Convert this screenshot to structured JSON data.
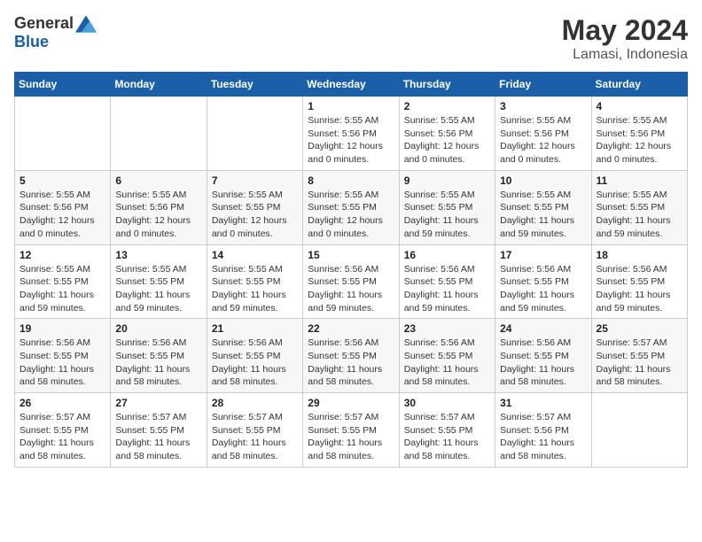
{
  "header": {
    "logo_general": "General",
    "logo_blue": "Blue",
    "month": "May 2024",
    "location": "Lamasi, Indonesia"
  },
  "weekdays": [
    "Sunday",
    "Monday",
    "Tuesday",
    "Wednesday",
    "Thursday",
    "Friday",
    "Saturday"
  ],
  "weeks": [
    [
      {
        "day": "",
        "info": ""
      },
      {
        "day": "",
        "info": ""
      },
      {
        "day": "",
        "info": ""
      },
      {
        "day": "1",
        "info": "Sunrise: 5:55 AM\nSunset: 5:56 PM\nDaylight: 12 hours and 0 minutes."
      },
      {
        "day": "2",
        "info": "Sunrise: 5:55 AM\nSunset: 5:56 PM\nDaylight: 12 hours and 0 minutes."
      },
      {
        "day": "3",
        "info": "Sunrise: 5:55 AM\nSunset: 5:56 PM\nDaylight: 12 hours and 0 minutes."
      },
      {
        "day": "4",
        "info": "Sunrise: 5:55 AM\nSunset: 5:56 PM\nDaylight: 12 hours and 0 minutes."
      }
    ],
    [
      {
        "day": "5",
        "info": "Sunrise: 5:55 AM\nSunset: 5:56 PM\nDaylight: 12 hours and 0 minutes."
      },
      {
        "day": "6",
        "info": "Sunrise: 5:55 AM\nSunset: 5:56 PM\nDaylight: 12 hours and 0 minutes."
      },
      {
        "day": "7",
        "info": "Sunrise: 5:55 AM\nSunset: 5:55 PM\nDaylight: 12 hours and 0 minutes."
      },
      {
        "day": "8",
        "info": "Sunrise: 5:55 AM\nSunset: 5:55 PM\nDaylight: 12 hours and 0 minutes."
      },
      {
        "day": "9",
        "info": "Sunrise: 5:55 AM\nSunset: 5:55 PM\nDaylight: 11 hours and 59 minutes."
      },
      {
        "day": "10",
        "info": "Sunrise: 5:55 AM\nSunset: 5:55 PM\nDaylight: 11 hours and 59 minutes."
      },
      {
        "day": "11",
        "info": "Sunrise: 5:55 AM\nSunset: 5:55 PM\nDaylight: 11 hours and 59 minutes."
      }
    ],
    [
      {
        "day": "12",
        "info": "Sunrise: 5:55 AM\nSunset: 5:55 PM\nDaylight: 11 hours and 59 minutes."
      },
      {
        "day": "13",
        "info": "Sunrise: 5:55 AM\nSunset: 5:55 PM\nDaylight: 11 hours and 59 minutes."
      },
      {
        "day": "14",
        "info": "Sunrise: 5:55 AM\nSunset: 5:55 PM\nDaylight: 11 hours and 59 minutes."
      },
      {
        "day": "15",
        "info": "Sunrise: 5:56 AM\nSunset: 5:55 PM\nDaylight: 11 hours and 59 minutes."
      },
      {
        "day": "16",
        "info": "Sunrise: 5:56 AM\nSunset: 5:55 PM\nDaylight: 11 hours and 59 minutes."
      },
      {
        "day": "17",
        "info": "Sunrise: 5:56 AM\nSunset: 5:55 PM\nDaylight: 11 hours and 59 minutes."
      },
      {
        "day": "18",
        "info": "Sunrise: 5:56 AM\nSunset: 5:55 PM\nDaylight: 11 hours and 59 minutes."
      }
    ],
    [
      {
        "day": "19",
        "info": "Sunrise: 5:56 AM\nSunset: 5:55 PM\nDaylight: 11 hours and 58 minutes."
      },
      {
        "day": "20",
        "info": "Sunrise: 5:56 AM\nSunset: 5:55 PM\nDaylight: 11 hours and 58 minutes."
      },
      {
        "day": "21",
        "info": "Sunrise: 5:56 AM\nSunset: 5:55 PM\nDaylight: 11 hours and 58 minutes."
      },
      {
        "day": "22",
        "info": "Sunrise: 5:56 AM\nSunset: 5:55 PM\nDaylight: 11 hours and 58 minutes."
      },
      {
        "day": "23",
        "info": "Sunrise: 5:56 AM\nSunset: 5:55 PM\nDaylight: 11 hours and 58 minutes."
      },
      {
        "day": "24",
        "info": "Sunrise: 5:56 AM\nSunset: 5:55 PM\nDaylight: 11 hours and 58 minutes."
      },
      {
        "day": "25",
        "info": "Sunrise: 5:57 AM\nSunset: 5:55 PM\nDaylight: 11 hours and 58 minutes."
      }
    ],
    [
      {
        "day": "26",
        "info": "Sunrise: 5:57 AM\nSunset: 5:55 PM\nDaylight: 11 hours and 58 minutes."
      },
      {
        "day": "27",
        "info": "Sunrise: 5:57 AM\nSunset: 5:55 PM\nDaylight: 11 hours and 58 minutes."
      },
      {
        "day": "28",
        "info": "Sunrise: 5:57 AM\nSunset: 5:55 PM\nDaylight: 11 hours and 58 minutes."
      },
      {
        "day": "29",
        "info": "Sunrise: 5:57 AM\nSunset: 5:55 PM\nDaylight: 11 hours and 58 minutes."
      },
      {
        "day": "30",
        "info": "Sunrise: 5:57 AM\nSunset: 5:55 PM\nDaylight: 11 hours and 58 minutes."
      },
      {
        "day": "31",
        "info": "Sunrise: 5:57 AM\nSunset: 5:56 PM\nDaylight: 11 hours and 58 minutes."
      },
      {
        "day": "",
        "info": ""
      }
    ]
  ]
}
